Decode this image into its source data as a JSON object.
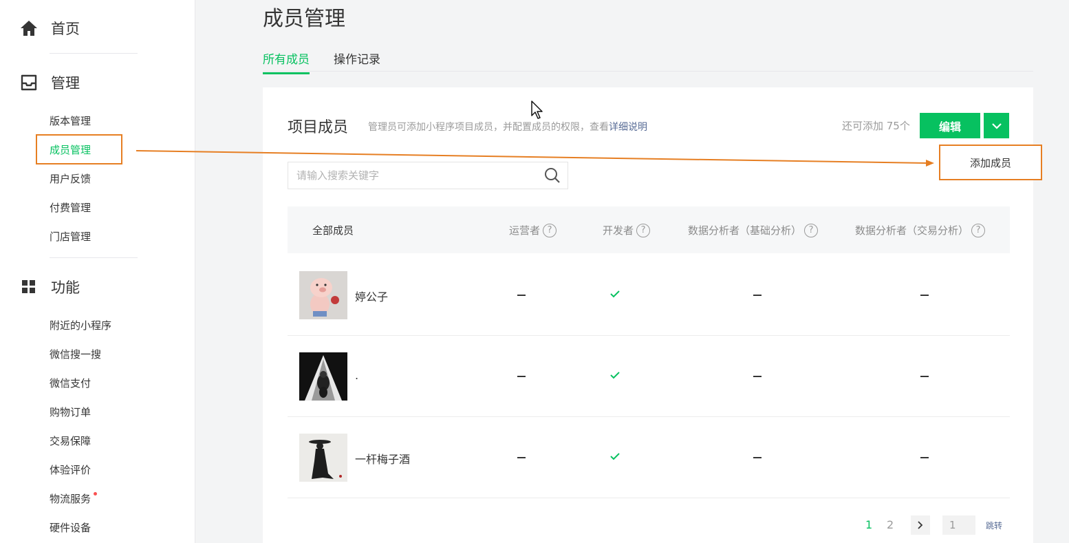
{
  "sidebar": {
    "home": {
      "label": "首页",
      "icon": "home-icon"
    },
    "manage": {
      "label": "管理",
      "icon": "inbox-icon",
      "items": [
        {
          "label": "版本管理"
        },
        {
          "label": "成员管理",
          "active": true
        },
        {
          "label": "用户反馈"
        },
        {
          "label": "付费管理"
        },
        {
          "label": "门店管理"
        }
      ]
    },
    "features": {
      "label": "功能",
      "icon": "grid-icon",
      "items": [
        {
          "label": "附近的小程序"
        },
        {
          "label": "微信搜一搜"
        },
        {
          "label": "微信支付"
        },
        {
          "label": "购物订单"
        },
        {
          "label": "交易保障"
        },
        {
          "label": "体验评价"
        },
        {
          "label": "物流服务",
          "badge_dot": true
        },
        {
          "label": "硬件设备"
        }
      ]
    }
  },
  "page": {
    "title": "成员管理",
    "tabs": [
      {
        "label": "所有成员",
        "active": true
      },
      {
        "label": "操作记录"
      }
    ]
  },
  "card": {
    "title": "项目成员",
    "description": "管理员可添加小程序项目成员，并配置成员的权限，查看",
    "description_link": "详细说明",
    "quota": "还可添加 75个",
    "edit_button": "编辑",
    "dropdown_item": "添加成员",
    "search": {
      "placeholder": "请输入搜索关键字",
      "value": ""
    },
    "columns": [
      "全部成员",
      "运营者",
      "开发者",
      "数据分析者（基础分析）",
      "数据分析者（交易分析）"
    ],
    "members": [
      {
        "name": "婷公子",
        "avatar": "pig-avatar",
        "roles": [
          "–",
          "✓",
          "–",
          "–"
        ]
      },
      {
        "name": ".",
        "avatar": "motorcycle-avatar",
        "roles": [
          "–",
          "✓",
          "–",
          "–"
        ]
      },
      {
        "name": "一杆梅子酒",
        "avatar": "swordsman-avatar",
        "roles": [
          "–",
          "✓",
          "–",
          "–"
        ]
      }
    ],
    "pagination": {
      "pages": [
        "1",
        "2"
      ],
      "current": "1",
      "input_value": "1",
      "jump_label": "跳转"
    }
  },
  "colors": {
    "accent": "#07c160",
    "link": "#576b95",
    "annotation": "#e67e22"
  }
}
